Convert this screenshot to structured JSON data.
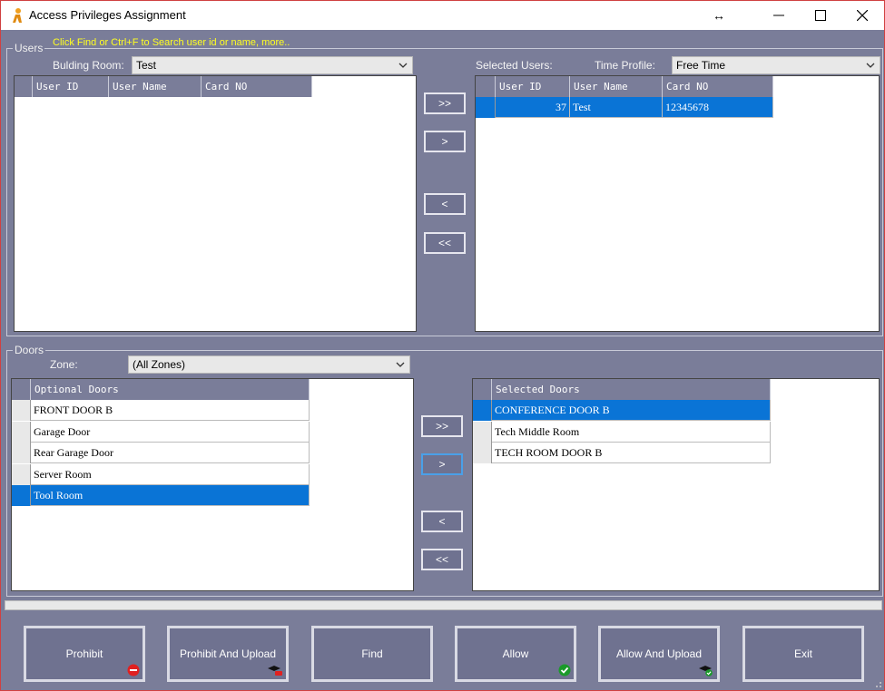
{
  "window": {
    "title": "Access Privileges Assignment"
  },
  "titlebar": {
    "resize_glyph": "↔",
    "minimize_glyph": "—",
    "maximize_glyph": "☐",
    "close_glyph": "✕"
  },
  "users": {
    "group_label": "Users",
    "hint": "Click Find or Ctrl+F  to Search user id or name,  more..",
    "building_room_label": "Bulding Room:",
    "building_room_value": "Test",
    "selected_users_label": "Selected Users:",
    "time_profile_label": "Time Profile:",
    "time_profile_value": "Free Time",
    "columns": [
      "User ID",
      "User Name",
      "Card NO"
    ],
    "available_rows": [],
    "selected_rows": [
      {
        "id": "37",
        "name": "Test",
        "card": "12345678"
      }
    ],
    "move_all_right": ">>",
    "move_right": ">",
    "move_left": "<",
    "move_all_left": "<<"
  },
  "doors": {
    "group_label": "Doors",
    "zone_label": "Zone:",
    "zone_value": "(All Zones)",
    "optional_header": "Optional Doors",
    "optional_rows": [
      "FRONT DOOR B",
      "Garage Door",
      "Rear Garage Door",
      "Server Room",
      "Tool Room"
    ],
    "optional_selected_index": 4,
    "selected_header": "Selected Doors",
    "selected_rows": [
      "CONFERENCE DOOR B",
      "Tech Middle Room",
      "TECH ROOM DOOR B"
    ],
    "selected_selected_index": 0,
    "move_all_right": ">>",
    "move_right": ">",
    "move_left": "<",
    "move_all_left": "<<"
  },
  "actions": {
    "prohibit": "Prohibit",
    "prohibit_upload": "Prohibit And Upload",
    "find": "Find",
    "allow": "Allow",
    "allow_upload": "Allow And Upload",
    "exit": "Exit"
  },
  "colors": {
    "background": "#7a7d99",
    "selection": "#0a74d6",
    "hint": "#ffff20"
  }
}
